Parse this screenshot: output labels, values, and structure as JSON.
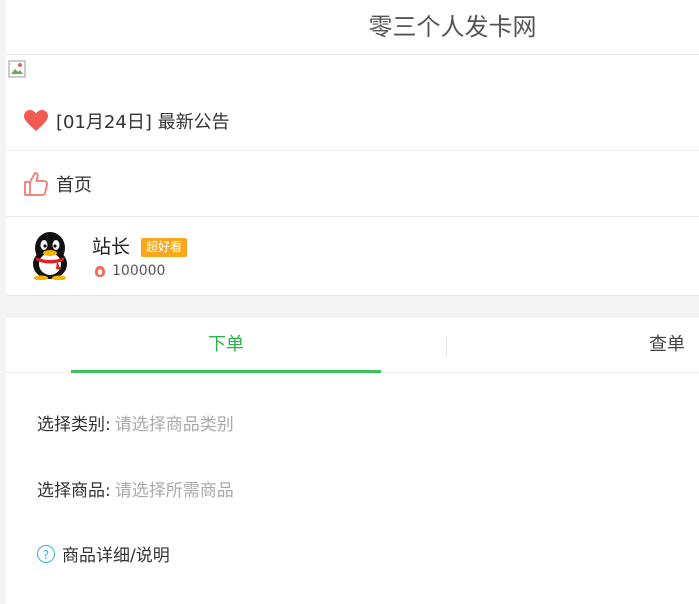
{
  "header": {
    "title": "零三个人发卡网"
  },
  "menu": {
    "notice_label": "[01月24日] 最新公告",
    "home_label": "首页"
  },
  "user": {
    "name": "站长",
    "badge": "超好看",
    "coins": "100000"
  },
  "tabs": {
    "order_label": "下单",
    "query_label": "查单"
  },
  "form": {
    "category_label": "选择类别:",
    "category_placeholder": "请选择商品类别",
    "product_label": "选择商品:",
    "product_placeholder": "请选择所需商品",
    "detail_label": "商品详细/说明"
  },
  "colors": {
    "accent_green": "#2bb24c",
    "badge_orange": "#f8a81a",
    "heart_red": "#f25b4f"
  }
}
